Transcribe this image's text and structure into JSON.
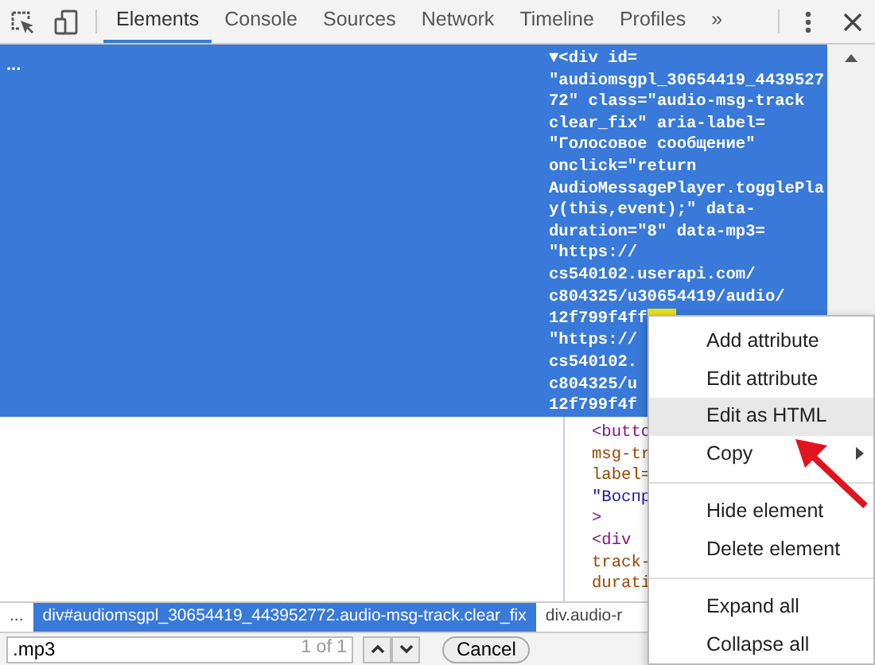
{
  "toolbar": {
    "tabs": [
      {
        "label": "Elements",
        "selected": true
      },
      {
        "label": "Console",
        "selected": false
      },
      {
        "label": "Sources",
        "selected": false
      },
      {
        "label": "Network",
        "selected": false
      },
      {
        "label": "Timeline",
        "selected": false
      },
      {
        "label": "Profiles",
        "selected": false
      }
    ],
    "overflow": "»"
  },
  "dom_tree": {
    "ellipsis": "...",
    "selected_lines": [
      {
        "text": "▼<div id=",
        "match": false
      },
      {
        "text": "\"audiomsgpl_30654419_4439527",
        "match": false
      },
      {
        "text": "72\" class=\"audio-msg-track",
        "match": false
      },
      {
        "text": "clear_fix\" aria-label=",
        "match": false
      },
      {
        "text": "\"Голосовое сообщение\"",
        "match": false
      },
      {
        "text": "onclick=\"return",
        "match": false
      },
      {
        "text": "AudioMessagePlayer.togglePla",
        "match": false
      },
      {
        "text": "y(this,event);\" data-",
        "match": false
      },
      {
        "text": "duration=\"8\" data-mp3=",
        "match": false
      },
      {
        "text": "\"https://",
        "match": false
      },
      {
        "text": "cs540102.userapi.com/",
        "match": false
      },
      {
        "text": "c804325/u30654419/audio/",
        "match": false
      },
      {
        "text": "12f799f4ff",
        "match": true
      },
      {
        "text": "\"https://",
        "match": false
      },
      {
        "text": "cs540102.",
        "match": false
      },
      {
        "text": "c804325/u",
        "match": false
      },
      {
        "text": "12f799f4f",
        "match": false
      }
    ],
    "child_lines": [
      {
        "text": "<butto",
        "kind": "tag"
      },
      {
        "text": "msg-tr",
        "kind": "attr"
      },
      {
        "text": "label=",
        "kind": "attr"
      },
      {
        "text": "\"Воспр",
        "kind": "value"
      },
      {
        "text": ">",
        "kind": "tag"
      },
      {
        "text": "<div",
        "kind": "tag"
      },
      {
        "text": "track-",
        "kind": "attr"
      },
      {
        "text": "durati",
        "kind": "attr"
      }
    ]
  },
  "breadcrumbs": {
    "ellipsis": "...",
    "items": [
      {
        "label": "div#audiomsgpl_30654419_443952772.audio-msg-track.clear_fix",
        "selected": true
      },
      {
        "label": "div.audio-r",
        "selected": false
      }
    ]
  },
  "search": {
    "value": ".mp3",
    "match_count": "1 of 1",
    "cancel": "Cancel"
  },
  "context_menu": {
    "items": [
      {
        "kind": "item",
        "label": "Add attribute",
        "selected": false,
        "submenu": false
      },
      {
        "kind": "item",
        "label": "Edit attribute",
        "selected": false,
        "submenu": false
      },
      {
        "kind": "item",
        "label": "Edit as HTML",
        "selected": true,
        "submenu": false
      },
      {
        "kind": "item",
        "label": "Copy",
        "selected": false,
        "submenu": true
      },
      {
        "kind": "separator"
      },
      {
        "kind": "item",
        "label": "Hide element",
        "selected": false,
        "submenu": false
      },
      {
        "kind": "item",
        "label": "Delete element",
        "selected": false,
        "submenu": false
      },
      {
        "kind": "separator"
      },
      {
        "kind": "item",
        "label": "Expand all",
        "selected": false,
        "submenu": false
      },
      {
        "kind": "item",
        "label": "Collapse all",
        "selected": false,
        "submenu": false
      }
    ]
  }
}
